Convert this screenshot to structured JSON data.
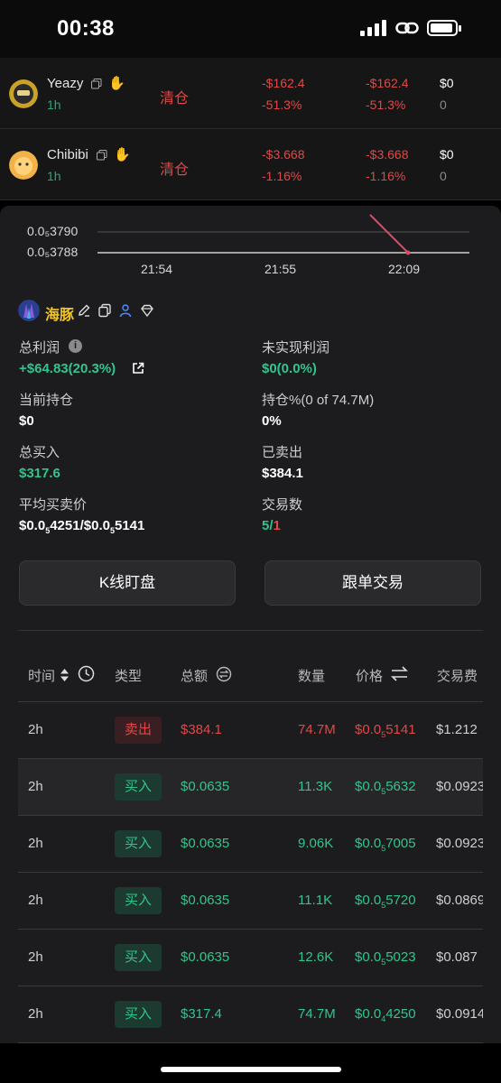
{
  "status": {
    "time": "00:38"
  },
  "holdings": [
    {
      "name": "Yeazy",
      "age": "1h",
      "action": "清仓",
      "pnl1": "-$162.4",
      "pct1": "-51.3%",
      "pnl2": "-$162.4",
      "pct2": "-51.3%",
      "bal": "$0",
      "qty": "0"
    },
    {
      "name": "Chibibi",
      "age": "1h",
      "action": "清仓",
      "pnl1": "-$3.668",
      "pct1": "-1.16%",
      "pnl2": "-$3.668",
      "pct2": "-1.16%",
      "bal": "$0",
      "qty": "0"
    }
  ],
  "chart_data": {
    "type": "line",
    "y_ticks": [
      "0.0₅3790",
      "0.0₅3788"
    ],
    "x_ticks": [
      "21:54",
      "21:55",
      "22:09"
    ],
    "series": [
      {
        "x": [
          "22:09"
        ],
        "y": [
          3.788e-06
        ]
      }
    ],
    "line_color": "#e04866"
  },
  "trader": {
    "name": "海豚"
  },
  "stats": {
    "total_profit_label": "总利润",
    "total_profit_value": "+$64.83(20.3%)",
    "unrealized_label": "未实现利润",
    "unrealized_value": "$0(0.0%)",
    "holding_label": "当前持仓",
    "holding_value": "$0",
    "holding_pct_label": "持仓%(0 of 74.7M)",
    "holding_pct_value": "0%",
    "total_buy_label": "总买入",
    "total_buy_value": "$317.6",
    "sold_label": "已卖出",
    "sold_value": "$384.1",
    "avg_price_label": "平均买卖价",
    "avg_buy_pre": "$0.0",
    "avg_buy_sub": "5",
    "avg_buy_post": "4251",
    "avg_sell_pre": "/$0.0",
    "avg_sell_sub": "5",
    "avg_sell_post": "5141",
    "trades_label": "交易数",
    "trades_buy": "5",
    "trades_sep": "/",
    "trades_sell": "1"
  },
  "buttons": {
    "kline": "K线盯盘",
    "copy_trade": "跟单交易"
  },
  "table": {
    "headers": {
      "time": "时间",
      "type": "类型",
      "amount": "总额",
      "qty": "数量",
      "price": "价格",
      "fee": "交易费"
    },
    "rows": [
      {
        "time": "2h",
        "type": "卖出",
        "side": "sell",
        "amount": "$384.1",
        "qty": "74.7M",
        "price_pre": "$0.0",
        "price_sub": "5",
        "price_post": "5141",
        "fee": "$1.212"
      },
      {
        "time": "2h",
        "type": "买入",
        "side": "buy",
        "amount": "$0.0635",
        "qty": "11.3K",
        "price_pre": "$0.0",
        "price_sub": "5",
        "price_post": "5632",
        "fee": "$0.0923"
      },
      {
        "time": "2h",
        "type": "买入",
        "side": "buy",
        "amount": "$0.0635",
        "qty": "9.06K",
        "price_pre": "$0.0",
        "price_sub": "5",
        "price_post": "7005",
        "fee": "$0.0923"
      },
      {
        "time": "2h",
        "type": "买入",
        "side": "buy",
        "amount": "$0.0635",
        "qty": "11.1K",
        "price_pre": "$0.0",
        "price_sub": "5",
        "price_post": "5720",
        "fee": "$0.0869"
      },
      {
        "time": "2h",
        "type": "买入",
        "side": "buy",
        "amount": "$0.0635",
        "qty": "12.6K",
        "price_pre": "$0.0",
        "price_sub": "5",
        "price_post": "5023",
        "fee": "$0.087"
      },
      {
        "time": "2h",
        "type": "买入",
        "side": "buy",
        "amount": "$317.4",
        "qty": "74.7M",
        "price_pre": "$0.0",
        "price_sub": "4",
        "price_post": "4250",
        "fee": "$0.0914"
      }
    ]
  },
  "colors": {
    "green": "#32c48d",
    "red": "#e04848",
    "gold": "#f0c52a"
  }
}
